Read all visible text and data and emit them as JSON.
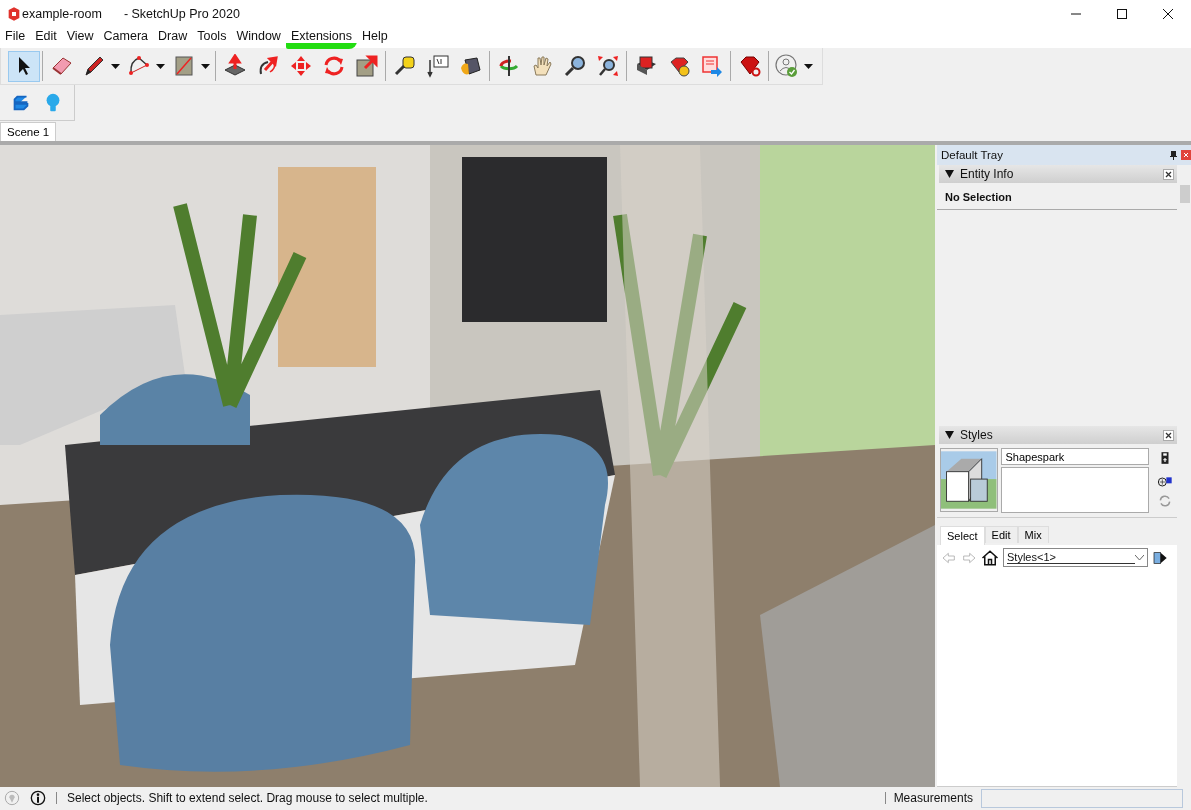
{
  "window": {
    "title": "example-room",
    "app": "- SketchUp Pro 2020"
  },
  "menu": [
    {
      "label": "File",
      "marked": false
    },
    {
      "label": "Edit",
      "marked": false
    },
    {
      "label": "View",
      "marked": false
    },
    {
      "label": "Camera",
      "marked": false
    },
    {
      "label": "Draw",
      "marked": false
    },
    {
      "label": "Tools",
      "marked": false
    },
    {
      "label": "Window",
      "marked": false
    },
    {
      "label": "Extensions",
      "marked": true
    },
    {
      "label": "Help",
      "marked": false
    }
  ],
  "toolbar": {
    "groups": [
      [
        {
          "selected": true,
          "dropdown": false
        }
      ],
      [
        {
          "selected": false,
          "dropdown": false
        },
        {
          "selected": false,
          "dropdown": true
        },
        {
          "selected": false,
          "dropdown": true
        },
        {
          "selected": false,
          "dropdown": true
        }
      ],
      [
        {
          "selected": false,
          "dropdown": false
        },
        {
          "selected": false,
          "dropdown": false
        },
        {
          "selected": false,
          "dropdown": false
        },
        {
          "selected": false,
          "dropdown": false
        },
        {
          "selected": false,
          "dropdown": false
        }
      ],
      [
        {
          "selected": false,
          "dropdown": false
        },
        {
          "selected": false,
          "dropdown": false
        },
        {
          "selected": false,
          "dropdown": false
        }
      ],
      [
        {
          "selected": false,
          "dropdown": false
        },
        {
          "selected": false,
          "dropdown": false
        },
        {
          "selected": false,
          "dropdown": false
        },
        {
          "selected": false,
          "dropdown": false
        }
      ],
      [
        {
          "selected": false,
          "dropdown": false
        },
        {
          "selected": false,
          "dropdown": false
        },
        {
          "selected": false,
          "dropdown": false
        }
      ],
      [
        {
          "selected": false,
          "dropdown": false
        }
      ],
      [
        {
          "selected": false,
          "dropdown": true
        }
      ]
    ]
  },
  "scenes": [
    {
      "label": "Scene 1",
      "selected": true
    }
  ],
  "tray": {
    "title": "Default Tray",
    "entity_info": {
      "title": "Entity Info",
      "expanded": true,
      "text": "No Selection"
    },
    "styles": {
      "title": "Styles",
      "expanded": true,
      "name": "Shapespark",
      "tabs": [
        {
          "label": "Select",
          "selected": true
        },
        {
          "label": "Edit",
          "selected": false
        },
        {
          "label": "Mix",
          "selected": false
        }
      ],
      "collection": "Styles<1>"
    }
  },
  "status_bar": {
    "hint": "Select objects. Shift to extend select. Drag mouse to select multiple.",
    "measurements_label": "Measurements"
  }
}
